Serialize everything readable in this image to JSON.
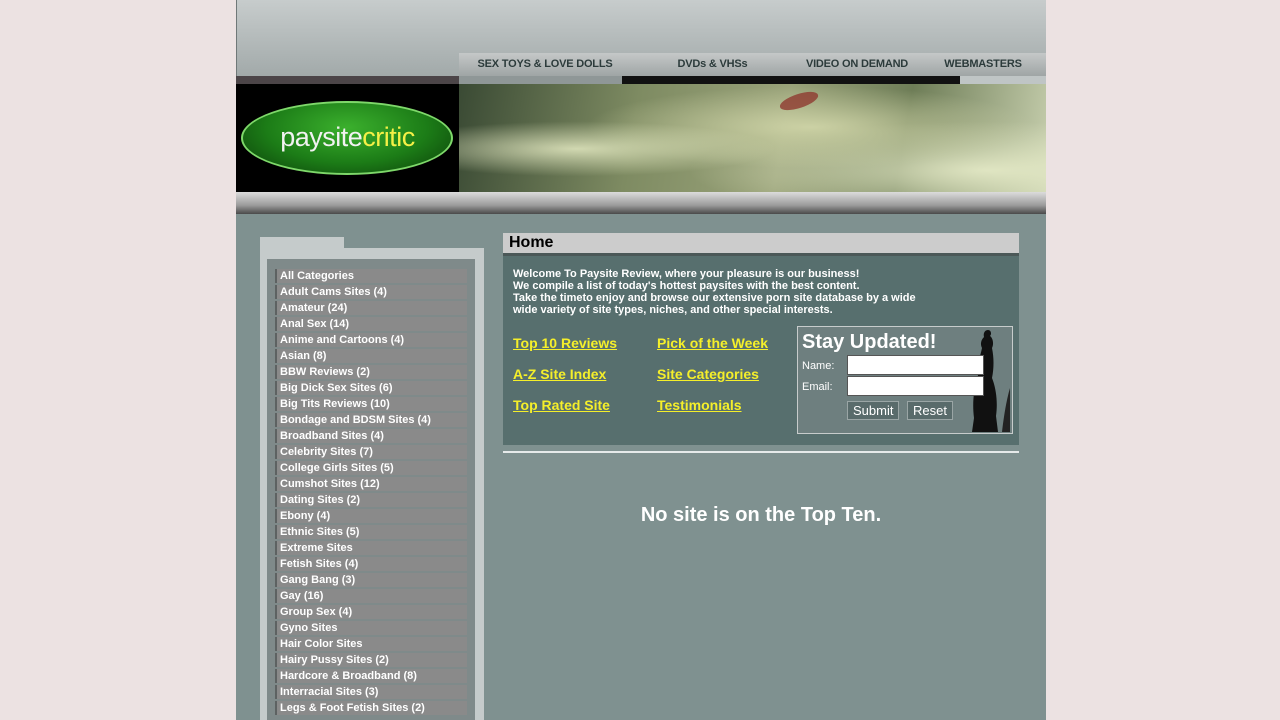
{
  "nav": {
    "items": [
      "SEX TOYS & LOVE DOLLS",
      "DVDs & VHSs",
      "VIDEO ON DEMAND",
      "WEBMASTERS"
    ]
  },
  "logo": {
    "part1": "paysite",
    "part2": "critic"
  },
  "sidebar": {
    "categories": [
      "All Categories",
      "Adult Cams Sites (4)",
      "Amateur (24)",
      "Anal Sex (14)",
      "Anime and Cartoons (4)",
      "Asian (8)",
      "BBW Reviews (2)",
      "Big Dick Sex Sites (6)",
      "Big Tits Reviews (10)",
      "Bondage and BDSM Sites (4)",
      "Broadband Sites (4)",
      "Celebrity Sites (7)",
      "College Girls Sites (5)",
      "Cumshot Sites (12)",
      "Dating Sites (2)",
      "Ebony (4)",
      "Ethnic Sites (5)",
      "Extreme Sites",
      "Fetish Sites (4)",
      "Gang Bang (3)",
      "Gay (16)",
      "Group Sex (4)",
      "Gyno Sites",
      "Hair Color Sites",
      "Hairy Pussy Sites (2)",
      "Hardcore & Broadband (8)",
      "Interracial Sites (3)",
      "Legs & Foot Fetish Sites (2)"
    ]
  },
  "main": {
    "title": "Home",
    "welcome_lines": [
      "Welcome To Paysite Review, where your pleasure is our business!",
      "We compile a list of today's hottest paysites with the best content.",
      "Take the timeto enjoy and browse our extensive porn site database by a wide",
      "wide variety of site types, niches, and other special interests."
    ],
    "links": {
      "top10": "Top 10 Reviews",
      "pick": "Pick of the Week",
      "az": "A-Z Site Index",
      "categories": "Site Categories",
      "toprated": "Top Rated Site",
      "testimonials": "Testimonials"
    },
    "empty_message": "No site is on the Top Ten."
  },
  "stay_updated": {
    "title": "Stay Updated!",
    "name_label": "Name:",
    "email_label": "Email:",
    "name_value": "",
    "email_value": "",
    "submit_label": "Submit",
    "reset_label": "Reset"
  },
  "colors": {
    "page_bg": "#ece2e2",
    "site_bg": "#7f9190",
    "link_yellow": "#f5ef2a",
    "welcome_bg": "#576f6e"
  }
}
